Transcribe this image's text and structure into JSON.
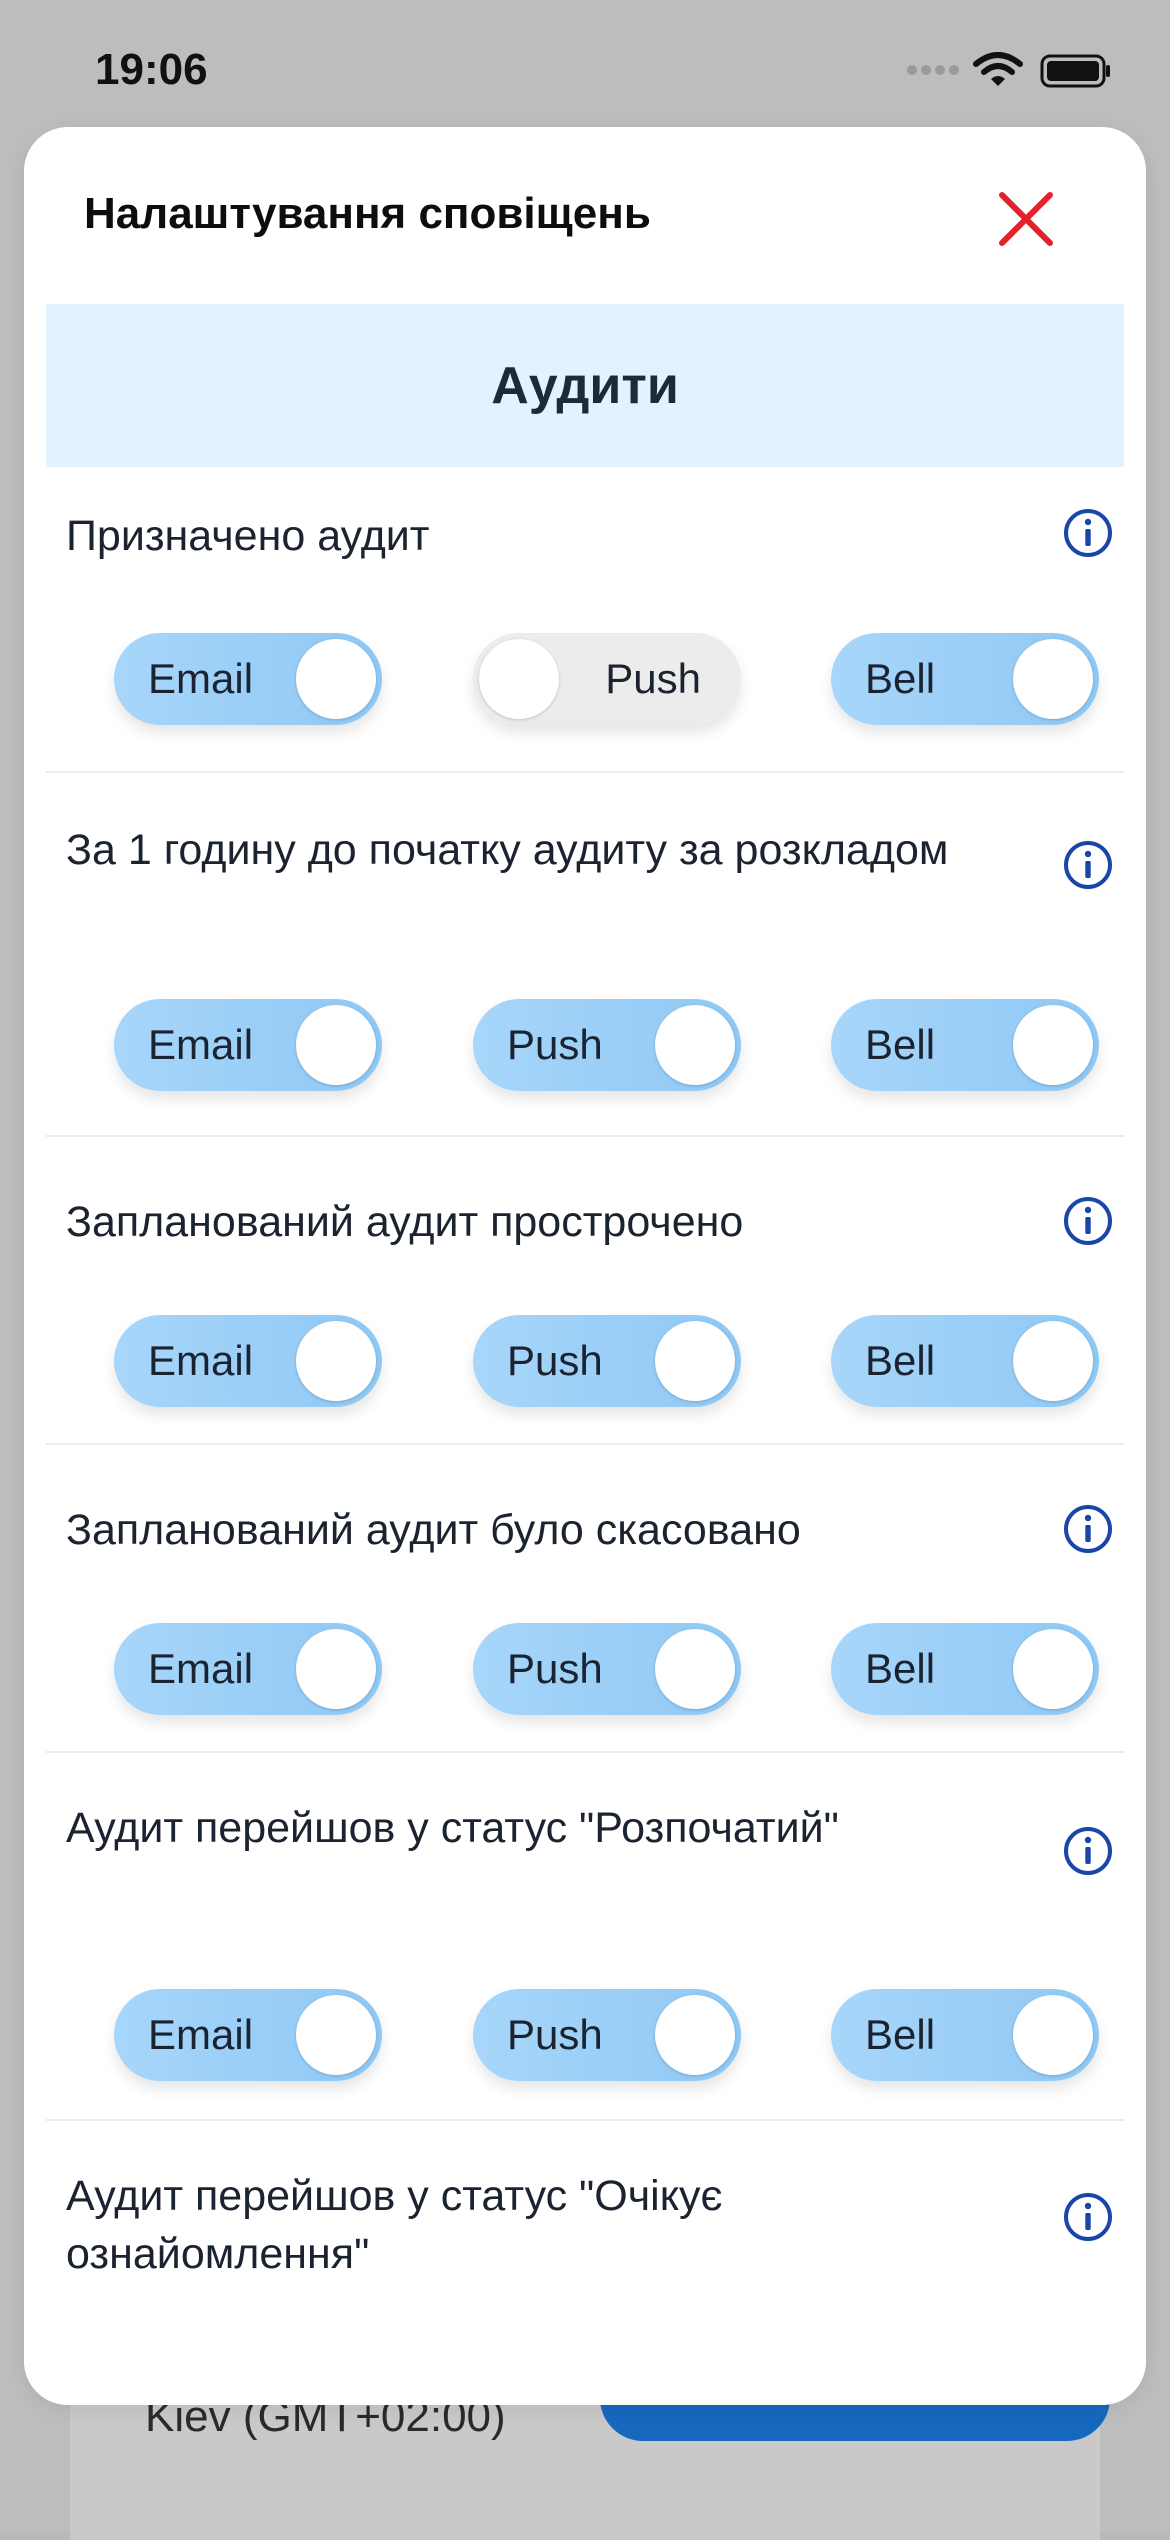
{
  "status_bar": {
    "time": "19:06"
  },
  "background": {
    "timezone_text": "Kiev (GMT+02:00)"
  },
  "modal": {
    "title": "Налаштування сповіщень",
    "section_title": "Аудити",
    "rows": [
      {
        "label": "Призначено аудит",
        "toggles": [
          {
            "label": "Email",
            "on": true
          },
          {
            "label": "Push",
            "on": false
          },
          {
            "label": "Bell",
            "on": true
          }
        ]
      },
      {
        "label": "За 1 годину до початку аудиту за розкладом",
        "toggles": [
          {
            "label": "Email",
            "on": true
          },
          {
            "label": "Push",
            "on": true
          },
          {
            "label": "Bell",
            "on": true
          }
        ]
      },
      {
        "label": "Запланований аудит прострочено",
        "toggles": [
          {
            "label": "Email",
            "on": true
          },
          {
            "label": "Push",
            "on": true
          },
          {
            "label": "Bell",
            "on": true
          }
        ]
      },
      {
        "label": "Запланований аудит було скасовано",
        "toggles": [
          {
            "label": "Email",
            "on": true
          },
          {
            "label": "Push",
            "on": true
          },
          {
            "label": "Bell",
            "on": true
          }
        ]
      },
      {
        "label": "Аудит перейшов у статус \"Розпочатий\"",
        "toggles": [
          {
            "label": "Email",
            "on": true
          },
          {
            "label": "Push",
            "on": true
          },
          {
            "label": "Bell",
            "on": true
          }
        ]
      },
      {
        "label": "Аудит перейшов у статус \"Очікує ознайомлення\"",
        "toggles": []
      }
    ]
  },
  "colors": {
    "accent": "#1a46a8",
    "close": "#e2212b",
    "toggle_on": "#9fd0f7",
    "toggle_off": "#ececec",
    "banner": "#e3f3fe"
  },
  "icons": {
    "close": "close-icon",
    "info": "info-icon",
    "signal": "signal-icon",
    "wifi": "wifi-icon",
    "battery": "battery-icon"
  }
}
